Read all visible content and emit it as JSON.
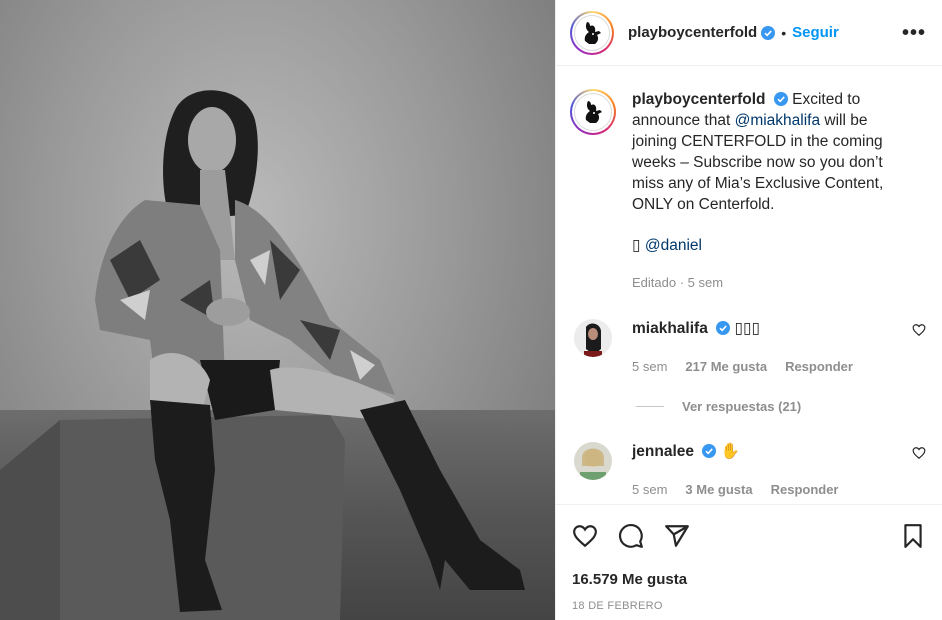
{
  "post": {
    "username": "playboycenterfold",
    "follow_label": "Seguir",
    "more_label": "•••",
    "caption_text": "Excited to announce that",
    "caption_mention": "@miakhalifa",
    "caption_rest": "will be joining CENTERFOLD in the coming weeks – Subscribe now so you don’t miss any of Mia’s Exclusive Content, ONLY on Centerfold.",
    "credit_icon": "camera-glyph",
    "credit_glyph": "▯",
    "credit_mention": "@daniel",
    "edited_label": "Editado",
    "edited_time": "5 sem",
    "likes_label": "16.579 Me gusta",
    "date_label": "18 de febrero"
  },
  "comments": [
    {
      "username": "miakhalifa",
      "text": "▯▯▯",
      "time": "5 sem",
      "likes": "217 Me gusta",
      "reply_label": "Responder",
      "view_replies": "Ver respuestas (21)"
    },
    {
      "username": "jennalee",
      "text": "✋",
      "time": "5 sem",
      "likes": "3 Me gusta",
      "reply_label": "Responder"
    }
  ],
  "colors": {
    "accent": "#0095f6",
    "mention": "#00376b",
    "muted": "#8e8e8e",
    "verified": "#3897f0"
  },
  "icons": [
    "heart-icon",
    "comment-icon",
    "share-icon",
    "bookmark-icon",
    "verified-icon",
    "more-icon",
    "playboy-logo-icon"
  ]
}
